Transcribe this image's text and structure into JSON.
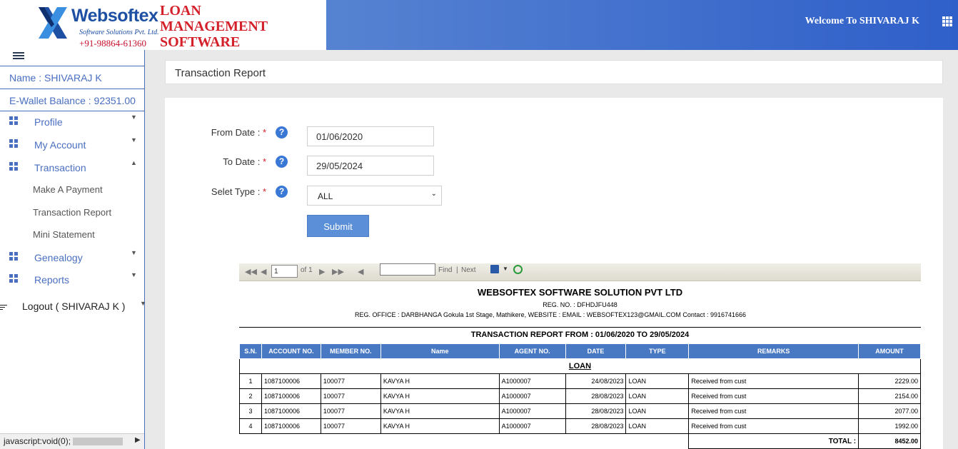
{
  "header": {
    "logo_name": "Websoftex",
    "logo_sub": "Software Solutions Pvt. Ltd.",
    "logo_phone": "+91-98864-61360",
    "app_title_1": "LOAN",
    "app_title_2": "MANAGEMENT",
    "app_title_3": "SOFTWARE",
    "welcome": "Welcome To SHIVARAJ K",
    "apps_icon": "grid-apps-icon",
    "colors": {
      "brand_blue": "#1d4fa3",
      "brand_red": "#d4202a",
      "header_gradient_start": "#6b95d6",
      "header_gradient_end": "#2f5fc9"
    }
  },
  "sidebar": {
    "name": "Name : SHIVARAJ K",
    "wallet": "E-Wallet Balance : 92351.00",
    "items": [
      {
        "label": "Profile",
        "icon": "grid-icon"
      },
      {
        "label": "My Account",
        "icon": "grid-icon"
      },
      {
        "label": "Transaction",
        "icon": "grid-icon"
      },
      {
        "label": "Genealogy",
        "icon": "grid-icon"
      },
      {
        "label": "Reports",
        "icon": "grid-icon"
      }
    ],
    "sub_items": [
      "Make A Payment",
      "Transaction Report",
      "Mini Statement"
    ],
    "logout": "Logout ( SHIVARAJ K )",
    "status": "javascript:void(0);"
  },
  "page_title": "Transaction Report",
  "form": {
    "from_label": "From Date : ",
    "from_value": "01/06/2020",
    "to_label": "To Date : ",
    "to_value": "29/05/2024",
    "type_label": "Selet Type : ",
    "type_value": "ALL",
    "required_mark": "*",
    "help_mark": "?",
    "submit": "Submit"
  },
  "viewer": {
    "page_value": "1",
    "page_of": "of 1",
    "find": "Find",
    "sep": "|",
    "next": "Next"
  },
  "report": {
    "company": "WEBSOFTEX SOFTWARE SOLUTION PVT LTD",
    "reg_no": "REG. NO. : DFHDJFU448",
    "office": "REG. OFFICE : DARBHANGA  Gokula 1st Stage, Mathikere, WEBSITE :        EMAIL : WEBSOFTEX123@GMAIL.COM   Contact : 9916741666",
    "title": "TRANSACTION REPORT FROM : 01/06/2020 TO 29/05/2024",
    "columns": [
      "S.N.",
      "ACCOUNT NO.",
      "MEMBER NO.",
      "Name",
      "AGENT NO.",
      "DATE",
      "TYPE",
      "REMARKS",
      "AMOUNT"
    ],
    "group": "LOAN",
    "rows": [
      [
        "1",
        "1087100006",
        "100077",
        "KAVYA H",
        "A1000007",
        "24/08/2023",
        "LOAN",
        "Received from cust",
        "2229.00"
      ],
      [
        "2",
        "1087100006",
        "100077",
        "KAVYA H",
        "A1000007",
        "28/08/2023",
        "LOAN",
        "Received from cust",
        "2154.00"
      ],
      [
        "3",
        "1087100006",
        "100077",
        "KAVYA H",
        "A1000007",
        "28/08/2023",
        "LOAN",
        "Received from cust",
        "2077.00"
      ],
      [
        "4",
        "1087100006",
        "100077",
        "KAVYA H",
        "A1000007",
        "28/08/2023",
        "LOAN",
        "Received from cust",
        "1992.00"
      ]
    ],
    "total_label": "TOTAL :",
    "total_value": "8452.00"
  }
}
